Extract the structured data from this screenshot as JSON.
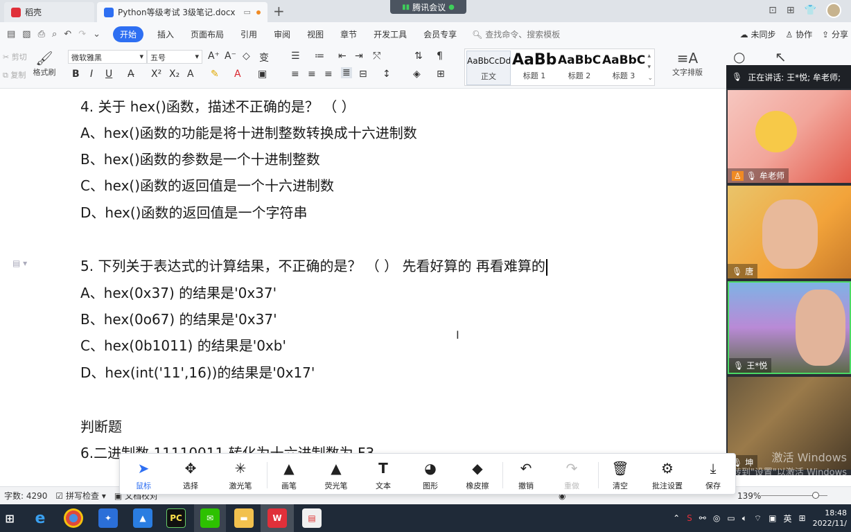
{
  "tabs": [
    {
      "label": "稻壳"
    },
    {
      "label": "Python等级考试 3级笔记.docx"
    }
  ],
  "meeting": {
    "label": "腾讯会议"
  },
  "menu": {
    "items": [
      "开始",
      "插入",
      "页面布局",
      "引用",
      "审阅",
      "视图",
      "章节",
      "开发工具",
      "会员专享"
    ],
    "search_placeholder": "查找命令、搜索模板",
    "right": [
      "未同步",
      "协作",
      "分享"
    ]
  },
  "ribbon": {
    "cut": "剪切",
    "copy": "复制",
    "format_painter": "格式刷",
    "font_name": "微软雅黑",
    "font_size": "五号",
    "styles": [
      {
        "preview": "AaBbCcDd",
        "label": "正文"
      },
      {
        "preview": "AaBb",
        "label": "标题 1"
      },
      {
        "preview": "AaBbC",
        "label": "标题 2"
      },
      {
        "preview": "AaBbC",
        "label": "标题 3"
      }
    ],
    "text_layout": "文字排版"
  },
  "document": {
    "lines": [
      "4. 关于 hex()函数，描述不正确的是？ （   ）",
      "A、hex()函数的功能是将十进制整数转换成十六进制数",
      "B、hex()函数的参数是一个十进制整数",
      "C、hex()函数的返回值是一个十六进制数",
      "D、hex()函数的返回值是一个字符串",
      "5. 下列关于表达式的计算结果，不正确的是？ （ ）   先看好算的  再看难算的",
      "A、hex(0x37) 的结果是'0x37'",
      "B、hex(0o67) 的结果是'0x37'",
      "C、hex(0b1011) 的结果是'0xb'",
      "D、hex(int('11',16))的结果是'0x17'",
      "判断题",
      "6.二进制数 11110011 转化为十六进制数为 F3"
    ]
  },
  "video": {
    "speaking": "正在讲话: 王*悦; 牟老师;",
    "participants": [
      {
        "name": "牟老师",
        "host": true
      },
      {
        "name": "唐",
        "host": false
      },
      {
        "name": "王*悦",
        "host": false
      },
      {
        "name": "坤",
        "host": false
      }
    ],
    "watermark_line1": "激活 Windows",
    "watermark_line2": "转到\"设置\"以激活 Windows"
  },
  "status": {
    "word_count": "字数: 4290",
    "spell_check": "拼写检查",
    "doc_check": "文档校对",
    "zoom": "139%"
  },
  "annotation_tools": [
    {
      "label": "鼠标",
      "icon": "cursor-icon",
      "state": "active"
    },
    {
      "label": "选择",
      "icon": "move-icon",
      "state": "normal"
    },
    {
      "label": "激光笔",
      "icon": "laser-icon",
      "state": "normal"
    },
    {
      "label": "画笔",
      "icon": "pen-icon",
      "state": "normal"
    },
    {
      "label": "荧光笔",
      "icon": "highlighter-icon",
      "state": "normal"
    },
    {
      "label": "文本",
      "icon": "text-icon",
      "state": "normal"
    },
    {
      "label": "图形",
      "icon": "shape-icon",
      "state": "normal"
    },
    {
      "label": "橡皮擦",
      "icon": "eraser-icon",
      "state": "normal"
    },
    {
      "label": "撤销",
      "icon": "undo-icon",
      "state": "normal"
    },
    {
      "label": "重做",
      "icon": "redo-icon",
      "state": "disabled"
    },
    {
      "label": "清空",
      "icon": "trash-icon",
      "state": "normal"
    },
    {
      "label": "批注设置",
      "icon": "annotation-settings-icon",
      "state": "normal"
    },
    {
      "label": "保存",
      "icon": "save-icon",
      "state": "normal"
    }
  ],
  "taskbar": {
    "ime": "英",
    "time": "18:48",
    "date": "2022/11/"
  },
  "colors": {
    "accent": "#2e6ff2",
    "taskbar": "#1f2a38",
    "video_panel": "#2b2f35"
  }
}
